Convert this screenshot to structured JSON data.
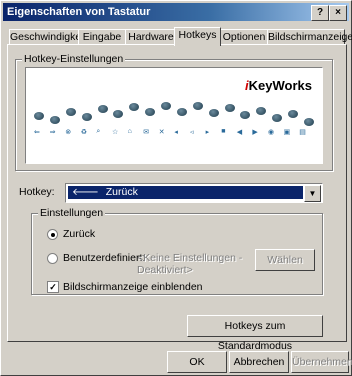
{
  "window": {
    "title": "Eigenschaften von Tastatur",
    "help_glyph": "?",
    "close_glyph": "×"
  },
  "tabs": [
    {
      "label": "Geschwindigkeit"
    },
    {
      "label": "Eingabe"
    },
    {
      "label": "Hardware"
    },
    {
      "label": "Hotkeys",
      "active": true
    },
    {
      "label": "Optionen"
    },
    {
      "label": "Bildschirmanzeige"
    }
  ],
  "hotkey_group": {
    "title": "Hotkey-Einstellungen",
    "logo_prefix": "i",
    "logo_main": "KeyWorks"
  },
  "hotkey_field": {
    "label": "Hotkey:",
    "selected_icon": "back-arrow-icon",
    "selected_glyph": "🡐",
    "selected_value": "Zurück"
  },
  "settings_group": {
    "title": "Einstellungen",
    "radio_default": "Zurück",
    "radio_custom": "Benutzerdefiniert:",
    "custom_placeholder_line1": "<Keine Einstellungen -",
    "custom_placeholder_line2": "Deaktiviert>",
    "choose_button": "Wählen",
    "checkbox_label": "Bildschirmanzeige einblenden",
    "checkbox_checked": true,
    "checkbox_glyph": "✓"
  },
  "restore_button": "Hotkeys zum Standardmodus",
  "footer": {
    "ok": "OK",
    "cancel": "Abbrechen",
    "apply": "Übernehmen"
  },
  "colors": {
    "title_bar": "#0a246a",
    "selection": "#0a246a",
    "logo_accent": "#d00000"
  },
  "keyboard_icons": [
    "back-arrow-icon",
    "forward-arrow-icon",
    "stop-icon",
    "refresh-icon",
    "search-icon",
    "favorites-icon",
    "home-icon",
    "mail-icon",
    "mute-icon",
    "volume-down-icon",
    "volume-up-icon",
    "play-pause-icon",
    "stop-media-icon",
    "previous-track-icon",
    "next-track-icon",
    "media-icon",
    "my-computer-icon",
    "calculator-icon"
  ],
  "keyboard_glyphs": [
    "⇐",
    "⇒",
    "⊗",
    "♻",
    "⌕",
    "☆",
    "⌂",
    "✉",
    "✕",
    "◂",
    "◃",
    "▸",
    "■",
    "◀",
    "▶",
    "◉",
    "▣",
    "▤"
  ]
}
